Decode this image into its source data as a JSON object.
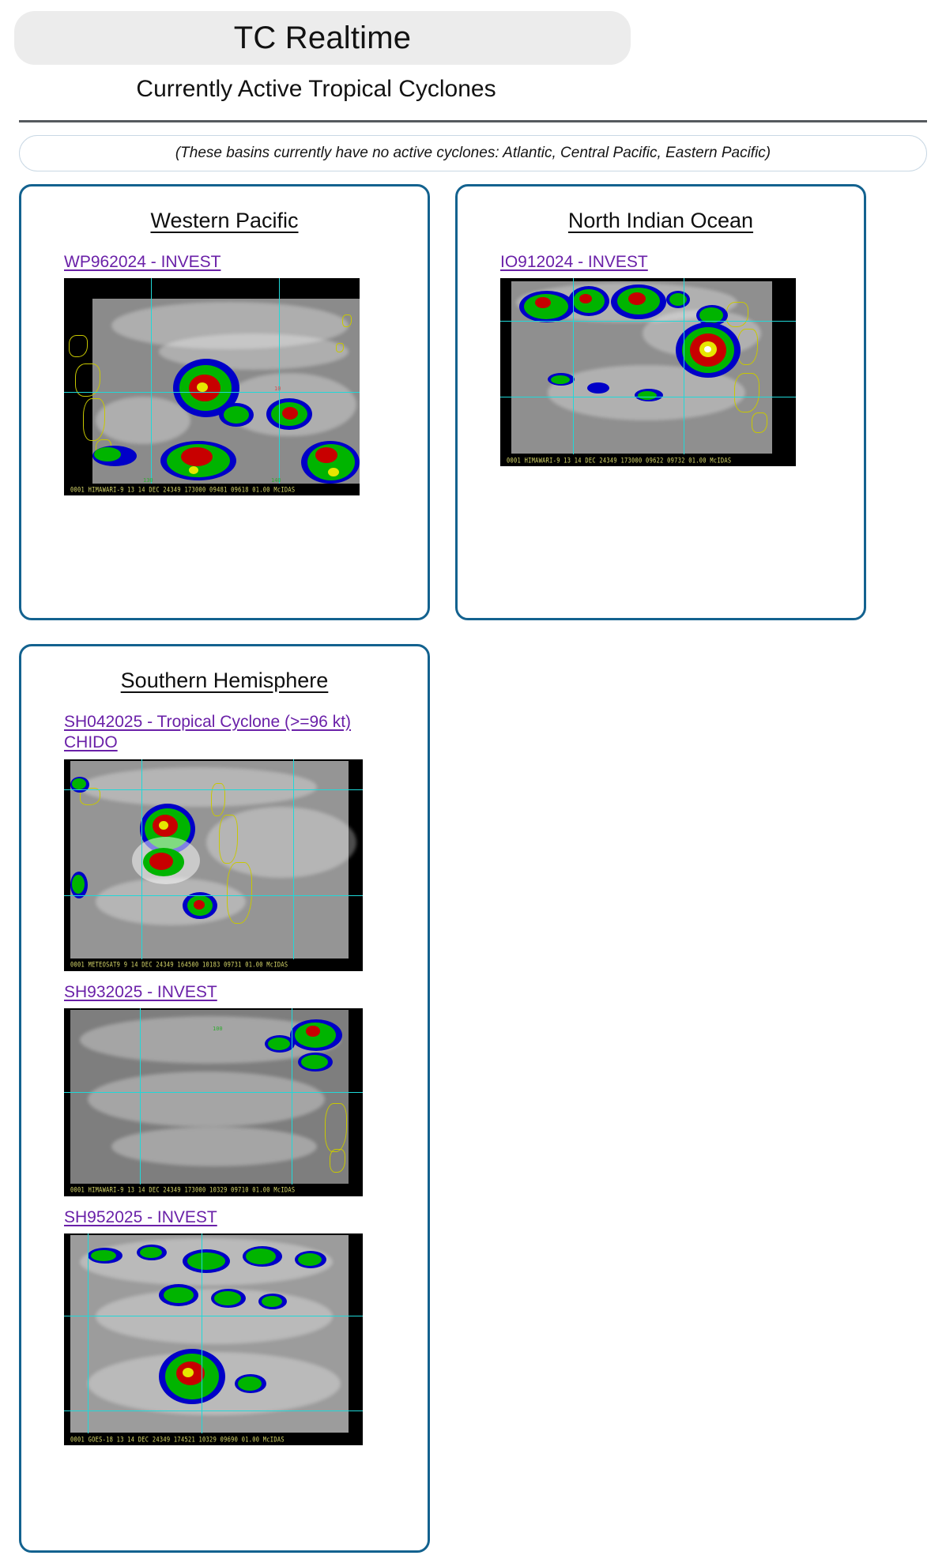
{
  "header": {
    "title": "TC Realtime",
    "subtitle": "Currently Active Tropical Cyclones"
  },
  "notice": {
    "text": "(These basins currently have no active cyclones: Atlantic, Central Pacific, Eastern Pacific)"
  },
  "colors": {
    "panel_border": "#13628f",
    "title_pill_bg": "#ececec",
    "link": "#6a20a8",
    "rule": "#555a5e",
    "notice_border": "#c9d8e4"
  },
  "basins": [
    {
      "id": "western-pacific",
      "title": "Western Pacific",
      "storms": [
        {
          "id": "WP962024",
          "label": "WP962024 - INVEST",
          "image_footer": "0001 HIMAWARI-9 13 14 DEC 24349 173000 09481 09618 01.00     McIDAS",
          "lat_labels": [
            "10"
          ],
          "lon_labels": [
            "130",
            "140"
          ]
        }
      ]
    },
    {
      "id": "north-indian-ocean",
      "title": "North Indian Ocean",
      "storms": [
        {
          "id": "IO912024",
          "label": "IO912024 - INVEST",
          "image_footer": "0001 HIMAWARI-9 13 14 DEC 24349 173000 09622 09732 01.00     McIDAS",
          "lat_labels": [],
          "lon_labels": []
        }
      ]
    },
    {
      "id": "southern-hemisphere",
      "title": "Southern Hemisphere",
      "storms": [
        {
          "id": "SH042025",
          "label": "SH042025 - Tropical Cyclone (>=96 kt) CHIDO",
          "image_footer": "0001 METEOSAT9   9 14 DEC 24349 164500 10183 09731 01.00     McIDAS",
          "lat_labels": [],
          "lon_labels": []
        },
        {
          "id": "SH932025",
          "label": "SH932025 - INVEST",
          "image_footer": "0001 HIMAWARI-9 13 14 DEC 24349 173000 10329 09710 01.00     McIDAS",
          "lat_labels": [],
          "lon_labels": []
        },
        {
          "id": "SH952025",
          "label": "SH952025 - INVEST",
          "image_footer": "0001 GOES-18    13 14 DEC 24349 174521 10329 09690 01.00     McIDAS",
          "lat_labels": [],
          "lon_labels": []
        }
      ]
    }
  ]
}
